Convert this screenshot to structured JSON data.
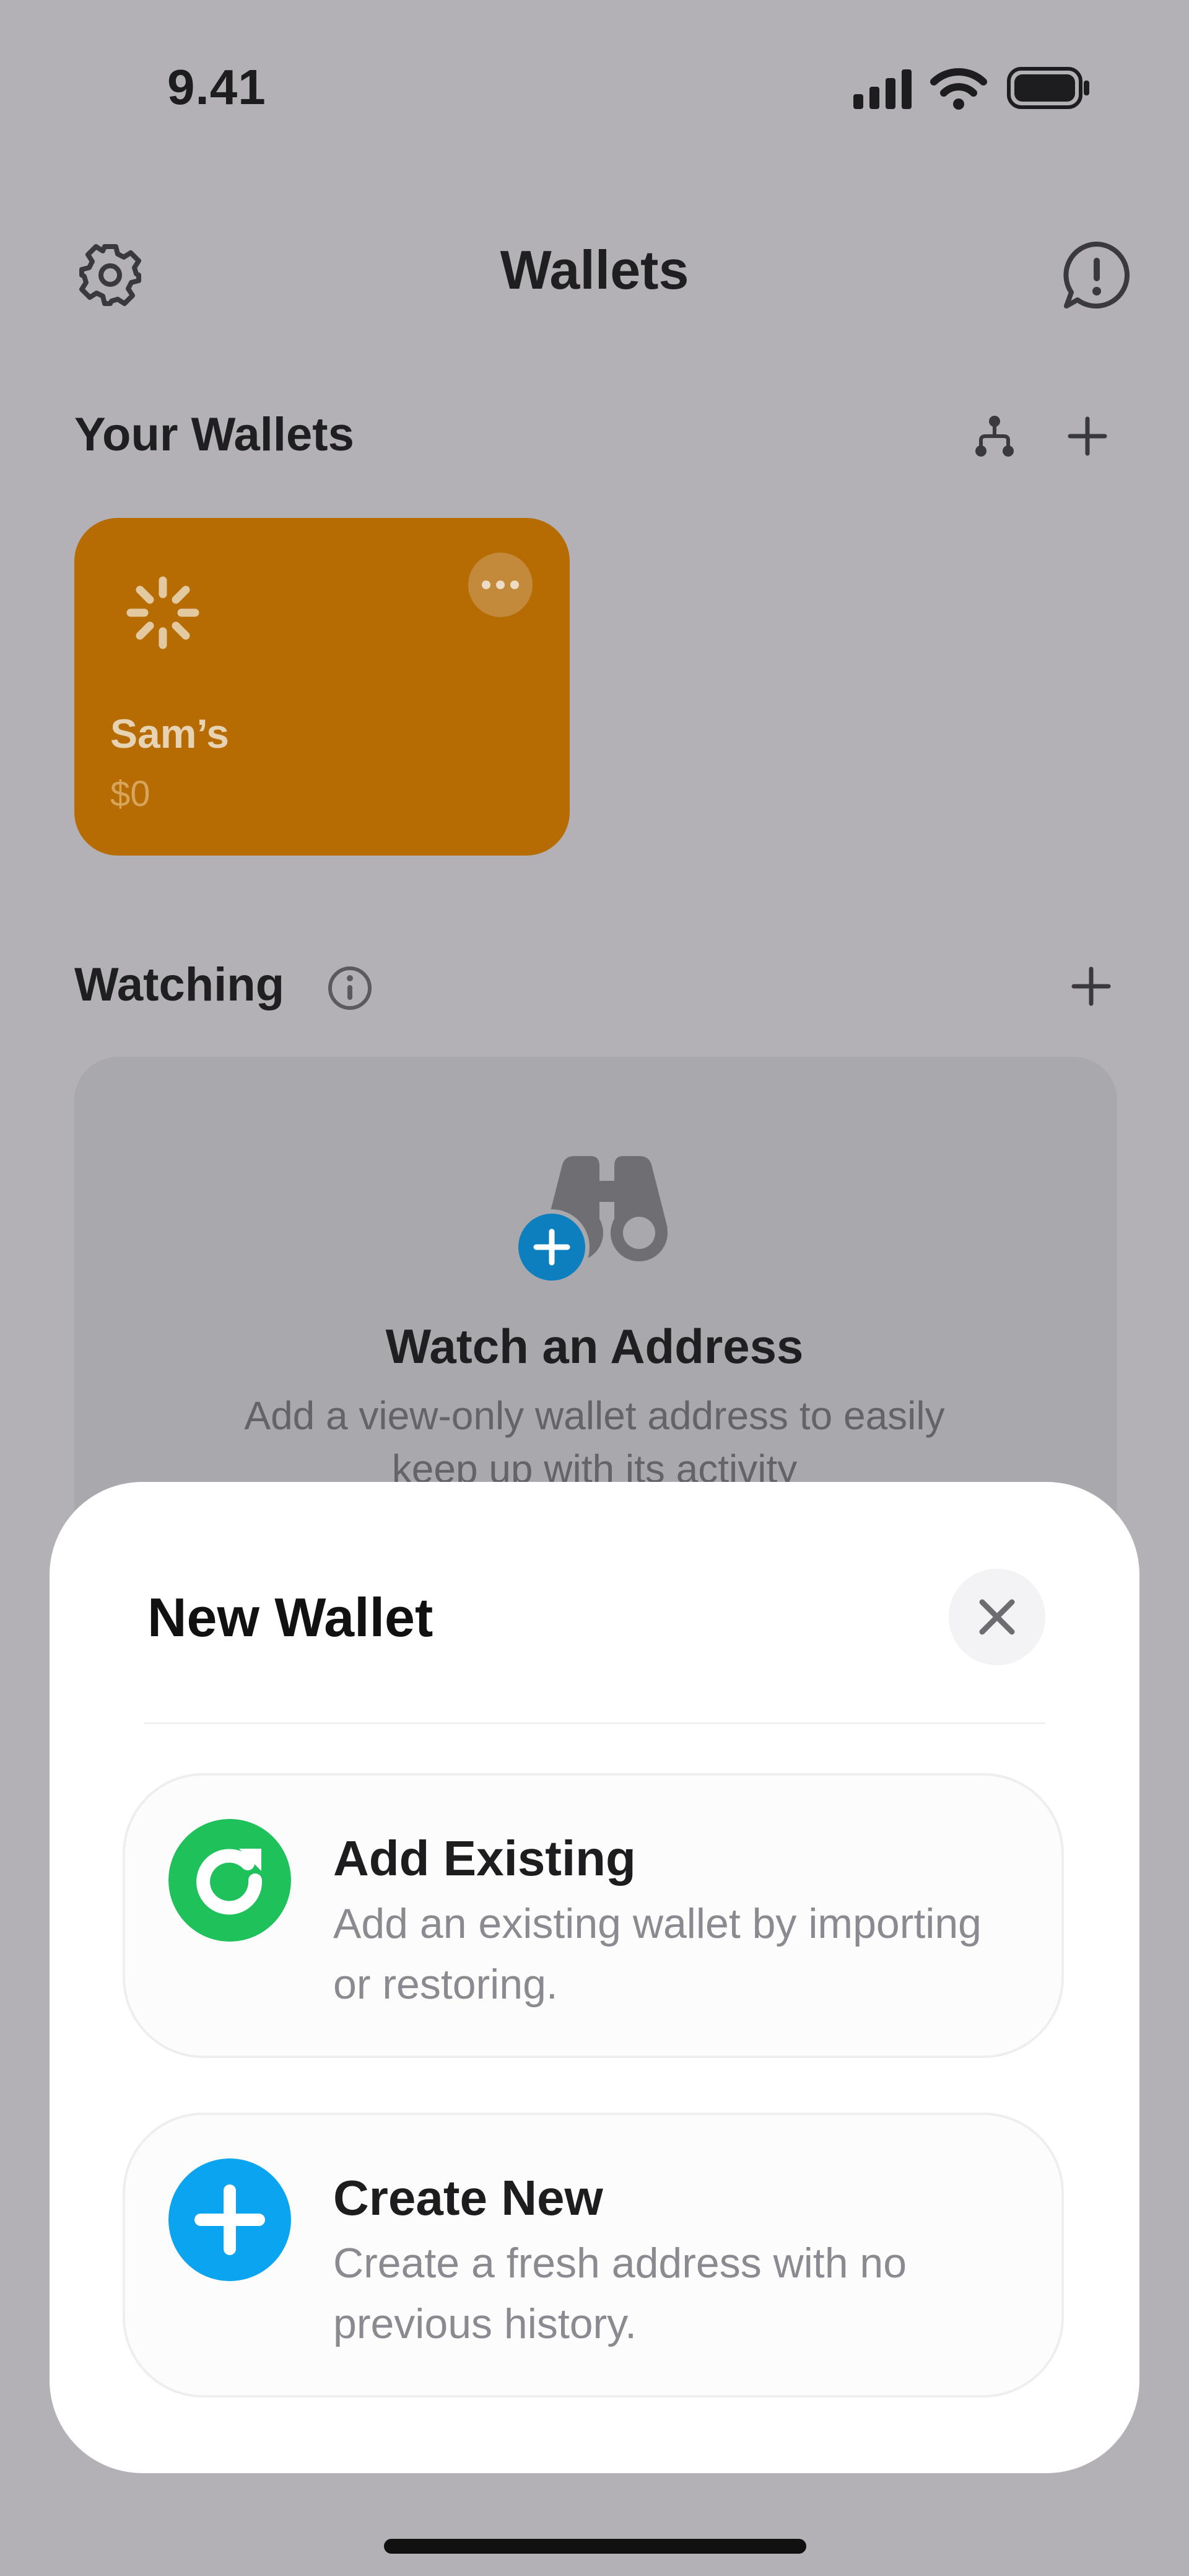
{
  "status_bar": {
    "time": "9.41"
  },
  "header": {
    "title": "Wallets"
  },
  "your_wallets": {
    "heading": "Your Wallets",
    "wallets": [
      {
        "name": "Sam’s",
        "balance": "$0",
        "color": "#b66c02"
      }
    ]
  },
  "watching": {
    "heading": "Watching",
    "empty_title": "Watch an Address",
    "empty_desc": "Add a view-only wallet address to easily keep up with its activity"
  },
  "sheet": {
    "title": "New Wallet",
    "options": [
      {
        "title": "Add Existing",
        "description": "Add an existing wallet by importing or restoring.",
        "icon": "restore-arrow-icon",
        "color": "#1fc15b"
      },
      {
        "title": "Create New",
        "description": "Create a fresh address with no previous history.",
        "icon": "plus-icon",
        "color": "#0aa4f0"
      }
    ]
  }
}
